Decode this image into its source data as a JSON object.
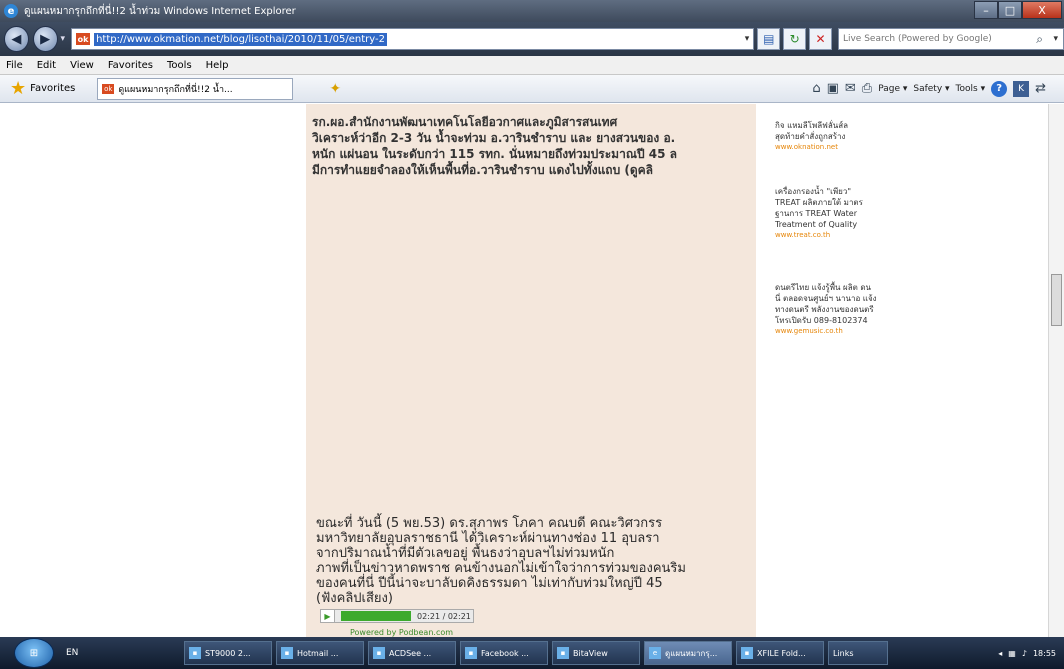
{
  "window": {
    "title": "ดูแผนหมากรุกถึกที่นี่!!2 น้ำท่วม   Windows Internet Explorer",
    "min": "–",
    "max": "□",
    "close": "X"
  },
  "address": {
    "url": "http://www.okmation.net/blog/lisothai/2010/11/05/entry-2",
    "search_placeholder": "Live Search (Powered by Google)"
  },
  "menu": [
    "File",
    "Edit",
    "View",
    "Favorites",
    "Tools",
    "Help"
  ],
  "favbar": {
    "favorites_label": "Favorites",
    "tab_title": "ดูแผนหมากรุกถึกที่นี่!!2 น้ำ..."
  },
  "cmdbar": {
    "page": "Page ▾",
    "safety": "Safety ▾",
    "tools": "Tools ▾"
  },
  "post": {
    "lines_top": [
      "รก.ผอ.สำนักงานพัฒนาเทคโนโลยีอวกาศและภูมิสารสนเทศ",
      "วิเคราะห์ว่าอีก 2-3 วัน น้ำจะท่วม อ.วารินชำราบ และ ยางสวนของ อ.",
      "หนัก แผ่นอน ในระดับกว่า 115 รทก. นั่นหมายถึงท่วมประมาณปี 45 ล",
      "มีการทำแยยจำลองให้เห็นพื้นที่อ.วารินชำราบ แดงไปทั้งแถบ (ดูคลิ"
    ],
    "lines_bottom": [
      "ขณะที่  วันนี้ (5 พย.53) ดร.สุภาพร โภคา คณบดี คณะวิศวกรร",
      "มหาวิทยาลัยอุบลราชธานี ได้วิเคราะห์ผ่านทางช่อง 11 อุบลรา",
      "จากปริมาณน้ำที่มีตัวเลขอยู่ พื้นธงว่าอุบลฯไม่ท่วมหนัก",
      "ภาพที่เป็นข่าวหาดพราช คนข้างนอกไม่เข้าใจว่าการท่วมของคนริม",
      "ของคนที่นี่ ปีนี้น่าจะบาลับดคิงธรรมดา  ไม่เท่ากับท่วมใหญ่ปี 45",
      "(ฟังคลิปเสียง)"
    ],
    "player_time": "02:21 / 02:21",
    "powered_by": "Powered by Podbean.com"
  },
  "sidebar": {
    "ads": [
      {
        "lines": [
          "กิจ แหมลีโพลีฟลั่นส์ล",
          "สุดท้ายคำสั่งถูกสร้าง"
        ],
        "link": "www.oknation.net"
      },
      {
        "lines": [
          "เครื่องกรองน้ำ \"เพียว\"",
          "TREAT ผลิตภายใต้ มาตร",
          "ฐานการ TREAT Water",
          "Treatment of Quality"
        ],
        "link": "www.treat.co.th"
      },
      {
        "lines": [
          "ดนตรีไทย แจ้งรู้พื้น ผลิต ดน",
          "นี่ ตลอดจนศูนย์ฯ นานาอ แจ้ง",
          "ทางดนตรี พลังงานของดนตรี",
          "โทรเปิดรับ 089-8102374"
        ],
        "link": "www.gemusic.co.th"
      }
    ]
  },
  "taskbar": {
    "lang": "EN",
    "items": [
      "ST9000 2...",
      "Hotmail ...",
      "ACDSee ...",
      "Facebook ...",
      "BitaView",
      "ดูแผนหมากรุ...",
      "XFILE Fold...",
      "Links"
    ],
    "clock": "18:55"
  }
}
